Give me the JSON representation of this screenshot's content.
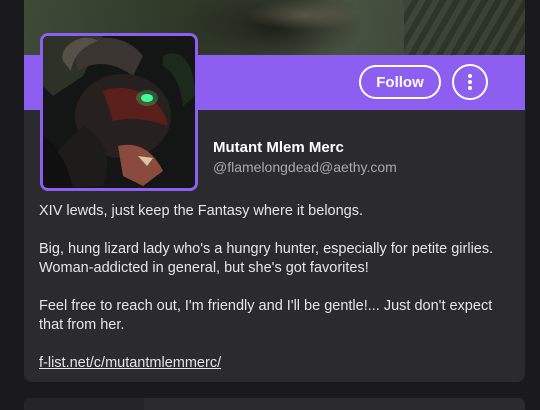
{
  "profile": {
    "display_name": "Mutant Mlem Merc",
    "handle": "@flamelongdead@aethy.com",
    "follow_label": "Follow",
    "more_icon": "more-vertical-icon",
    "bio": [
      "XIV lewds, just keep the Fantasy where it belongs.",
      "Big, hung lizard lady who's a hungry hunter, especially for petite girlies. Woman-addicted in general, but she's got favorites!",
      "Feel free to reach out, I'm friendly and I'll be gentle!... Just don't expect that from her."
    ],
    "link_text": "f-list.net/c/mutantmlemmerc/"
  },
  "colors": {
    "accent": "#8c5ff0",
    "card_bg": "#2b2b2e",
    "page_bg": "#1a1a1d"
  }
}
